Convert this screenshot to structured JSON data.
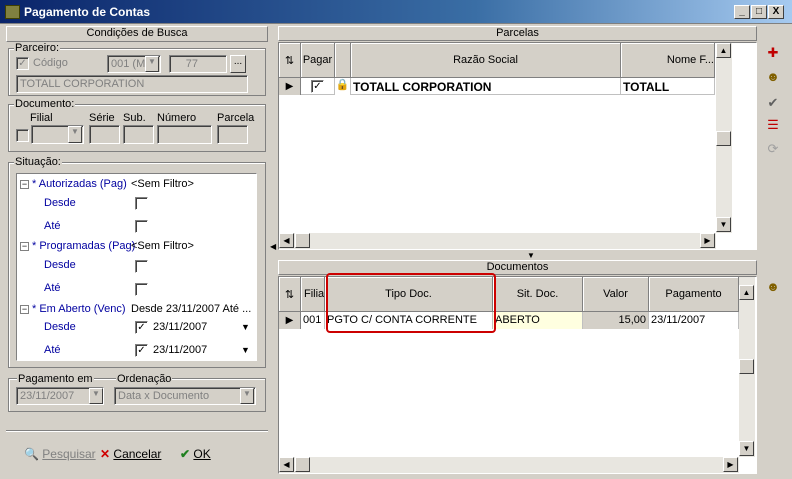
{
  "window": {
    "title": "Pagamento de Contas",
    "buttons": [
      "_",
      "□",
      "X"
    ]
  },
  "left": {
    "header": "Condições de Busca",
    "parceiro": {
      "label": "Parceiro:",
      "codigo_label": "Código",
      "codigo_checked": true,
      "code_select": "001 (M...",
      "number": "77",
      "more": "...",
      "name": "TOTALL CORPORATION"
    },
    "documento": {
      "label": "Documento:",
      "filial": "Filial",
      "serie": "Série",
      "sub": "Sub.",
      "numero": "Número",
      "parcela": "Parcela"
    },
    "situacao": {
      "label": "Situação:",
      "items": [
        {
          "title": "* Autorizadas (Pag)",
          "filter": "<Sem Filtro>",
          "desde": "Desde",
          "ate": "Até"
        },
        {
          "title": "* Programadas (Pag)",
          "filter": "<Sem Filtro>",
          "desde": "Desde",
          "ate": "Até"
        },
        {
          "title": "* Em Aberto (Venc)",
          "filter": "Desde 23/11/2007 Até ...",
          "desde": "Desde",
          "desde_val": "23/11/2007",
          "ate": "Até",
          "ate_val": "23/11/2007"
        }
      ]
    },
    "pagamento_em": {
      "label": "Pagamento em",
      "value": "23/11/2007"
    },
    "ordenacao": {
      "label": "Ordenação",
      "value": "Data x Documento"
    },
    "buttons": {
      "pesquisar": "Pesquisar",
      "cancelar": "Cancelar",
      "ok": "OK"
    }
  },
  "parcelas": {
    "header": "Parcelas",
    "columns": [
      "Pagar",
      "Razão Social",
      "Nome F..."
    ],
    "rows": [
      {
        "pagar": true,
        "razao": "TOTALL CORPORATION",
        "nome": "TOTALL"
      }
    ]
  },
  "documentos": {
    "header": "Documentos",
    "columns": [
      "Filial",
      "Tipo Doc.",
      "Sit. Doc.",
      "Valor",
      "Pagamento"
    ],
    "rows": [
      {
        "filial": "001",
        "tipo": "PGTO C/ CONTA CORRENTE",
        "sit": "ABERTO",
        "valor": "15,00",
        "pagamento": "23/11/2007"
      }
    ]
  },
  "colors": {
    "title_start": "#0a246a",
    "highlight": "#cc0000",
    "field_yellow": "#ffffe0",
    "valor_bg": "#d4d0c8"
  },
  "icons": [
    "add-icon",
    "person-icon",
    "check-icon",
    "list-icon",
    "refresh-icon",
    "arrows-sort-icon",
    "lock-icon"
  ]
}
